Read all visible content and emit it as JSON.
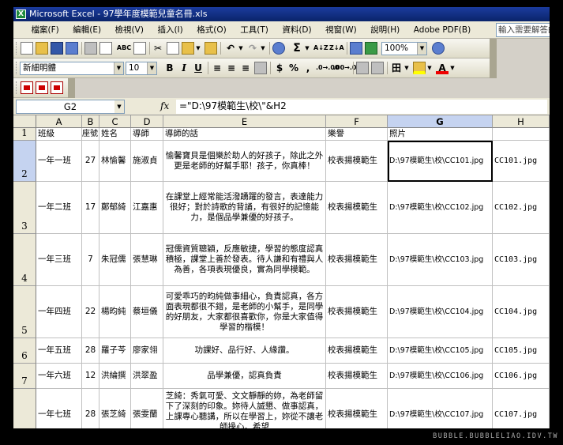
{
  "window": {
    "title": "Microsoft Excel - 97學年度模範兒童名冊.xls"
  },
  "menu": [
    "檔案(F)",
    "編輯(E)",
    "檢視(V)",
    "插入(I)",
    "格式(O)",
    "工具(T)",
    "資料(D)",
    "視窗(W)",
    "說明(H)",
    "Adobe PDF(B)"
  ],
  "help_box": "輸入需要解答的問題",
  "toolbar": {
    "spelling": "ABC",
    "cut": "✂",
    "dropdown": "▼",
    "undo": "↶",
    "redo": "↷",
    "autosum": "Σ",
    "sort_asc": "A↓Z",
    "sort_desc": "Z↓A",
    "zoom": "100%",
    "font_name": "新細明體",
    "font_size": "10",
    "bold": "B",
    "italic": "I",
    "underline": "U",
    "align_left": "≡",
    "align_center": "≡",
    "align_right": "≡",
    "currency": "$",
    "percent": "%",
    "comma": ",",
    "inc_decimal": ".0→.00",
    "dec_decimal": ".00→.0",
    "borders": "田",
    "font_color": "A"
  },
  "formula_bar": {
    "name_box": "G2",
    "fx": "fx",
    "formula": "=\"D:\\97模範生\\校\\\"&H2"
  },
  "columns": [
    "A",
    "B",
    "C",
    "D",
    "E",
    "F",
    "G",
    "H"
  ],
  "rows": [
    {
      "num": "1",
      "a": "班級",
      "b": "座號",
      "c": "姓名",
      "d": "導師",
      "e": "導師的話",
      "f": "樂譽",
      "g": "照片",
      "h": ""
    },
    {
      "num": "2",
      "a": "一年一班",
      "b": "27",
      "c": "林愉馨",
      "d": "施淑貞",
      "e": "愉馨寶貝是個樂於助人的好孩子，除此之外更是老師的好幫手耶！孩子，你真棒！",
      "f": "校表揚模範生",
      "g": "D:\\97模範生\\校\\CC101.jpg",
      "h": "CC101.jpg"
    },
    {
      "num": "3",
      "a": "一年二班",
      "b": "17",
      "c": "鄭郁綺",
      "d": "江嘉惠",
      "e": "在課堂上經常能活潑踴躍的發言，表達能力很好；對於詩歌的背誦，有很好的記憶能力，是個品學兼優的好孩子。",
      "f": "校表揚模範生",
      "g": "D:\\97模範生\\校\\CC102.jpg",
      "h": "CC102.jpg"
    },
    {
      "num": "4",
      "a": "一年三班",
      "b": "7",
      "c": "朱冠儒",
      "d": "張慧琳",
      "e": "冠儒資質聰穎，反應敏捷，學習的態度認真積極，課堂上善於發表。待人謙和有禮與人為善，各項表現優良，實為同學模範。",
      "f": "校表揚模範生",
      "g": "D:\\97模範生\\校\\CC103.jpg",
      "h": "CC103.jpg"
    },
    {
      "num": "5",
      "a": "一年四班",
      "b": "22",
      "c": "楊昀純",
      "d": "蔡垣儀",
      "e": "可愛乖巧的昀純做事細心，負責認真，各方面表現都很不錯，是老師的小幫手，是同學的好朋友，大家都很喜歡你，你是大家值得學習的楷模！",
      "f": "校表揚模範生",
      "g": "D:\\97模範生\\校\\CC104.jpg",
      "h": "CC104.jpg"
    },
    {
      "num": "6",
      "a": "一年五班",
      "b": "28",
      "c": "羅子芩",
      "d": "廖家翎",
      "e": "功課好、品行好、人緣讚。",
      "f": "校表揚模範生",
      "g": "D:\\97模範生\\校\\CC105.jpg",
      "h": "CC105.jpg"
    },
    {
      "num": "7",
      "a": "一年六班",
      "b": "12",
      "c": "洪綸撰",
      "d": "洪翠盈",
      "e": "品學兼優，認真負責",
      "f": "校表揚模範生",
      "g": "D:\\97模範生\\校\\CC106.jpg",
      "h": "CC106.jpg"
    },
    {
      "num": "8",
      "a": "一年七班",
      "b": "28",
      "c": "張芝綺",
      "d": "張雯蘭",
      "e": "芝綺：秀氣可愛、文文靜靜的妳，為老師留下了深刻的印象。妳待人誠懇、做事認真，上課專心聽講，所以在學習上，妳從不讓老師操心。希望",
      "f": "校表揚模範生",
      "g": "D:\\97模範生\\校\\CC107.jpg",
      "h": "CC107.jpg"
    }
  ],
  "watermark": "BUBBLE.BUBBLELIAO.IDV.TW"
}
